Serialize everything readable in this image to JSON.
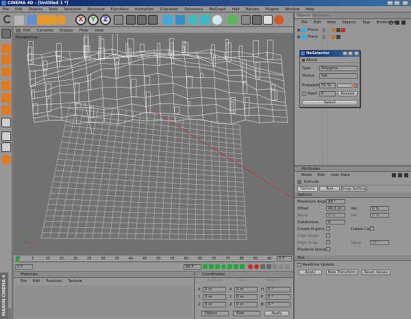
{
  "app": {
    "title": "CINEMA 4D - [Untitled 1 *]",
    "menu": [
      "File",
      "Edit",
      "Objects",
      "Tools",
      "Selection",
      "Structure",
      "Functions",
      "Animation",
      "Character",
      "Dynamics",
      "MoGraph",
      "Hair",
      "Render",
      "Plugins",
      "Window",
      "Help"
    ],
    "side_logo": "MAXON CINEMA 4D"
  },
  "toolbar": {
    "axis_x": "X",
    "axis_y": "Y",
    "axis_z": "Z",
    "icons": [
      "undo-icon",
      "redo-icon",
      "live-select-icon",
      "move-icon",
      "scale-icon",
      "rotate-icon",
      "x-axis-icon",
      "y-axis-icon",
      "z-axis-icon",
      "world-coordinates-icon",
      "render-view-icon",
      "render-picture-viewer-icon",
      "render-settings-icon",
      "cube-icon",
      "spline-pen-icon",
      "subdivision-icon",
      "array-icon",
      "flower-icon",
      "deformer-icon",
      "scene-icon",
      "camera-icon",
      "light-icon",
      "render-active-icon"
    ]
  },
  "viewport": {
    "menu": [
      "Edit",
      "Cameras",
      "Display",
      "Filter",
      "View"
    ],
    "label": "Perspective"
  },
  "object_manager": {
    "tabs": [
      "Objects",
      "Structure"
    ],
    "menu": [
      "File",
      "Edit",
      "View",
      "Objects",
      "Tags",
      "Bookmarks"
    ],
    "rows": [
      {
        "name": "Plane"
      },
      {
        "name": "Plane"
      }
    ]
  },
  "dialog": {
    "title": "NeSelector",
    "about_label": "About",
    "type_label": "Type",
    "type_value": "Polygons",
    "modus_label": "Modus",
    "modus_value": "Set",
    "probability_label": "Probability",
    "probability_value": "75 %",
    "probability_fraction": 0.75,
    "seed_label": "Seed",
    "seed_value": "0",
    "reseed_label": "Reseed",
    "select_label": "Select"
  },
  "attributes": {
    "title": "Attributes",
    "menu": [
      "Mode",
      "Edit",
      "User Data"
    ],
    "object_name": "Extrude",
    "tabs": [
      "Options",
      "Tool",
      "Snap Settings"
    ],
    "section_options": "Options",
    "max_angle_label": "Maximum Angle",
    "max_angle_value": "89 °",
    "offset_label": "Offset",
    "offset_value": "40.1 m",
    "var1_label": "Var.",
    "var1_value": "0 %",
    "bevel_label": "Bevel",
    "bevel_value": "0 m",
    "var2_label": "Var.",
    "var2_value": "0 %",
    "subdivision_label": "Subdivision",
    "subdivision_value": "0",
    "create_ngons_label": "Create N-gons",
    "create_caps_label": "Create Caps",
    "edge_angle_label": "Edge Angle",
    "edge_snap_label": "Edge Snap",
    "value_label": "Value",
    "value_value": "15 °",
    "preserve_groups_label": "Preserve Groups",
    "section_tool": "Tool",
    "realtime_label": "Realtime Update",
    "apply_label": "Apply",
    "new_transform_label": "New Transform",
    "reset_values_label": "Reset Values"
  },
  "timeline": {
    "ticks": [
      "0",
      "5",
      "10",
      "15",
      "20",
      "25",
      "30",
      "35",
      "40",
      "45",
      "50",
      "55",
      "60",
      "65",
      "70",
      "75",
      "80",
      "85",
      "90"
    ],
    "frame_end": "0 F",
    "field_start": "0 F",
    "field_end": "90 F",
    "field_cur": "90 F"
  },
  "materials": {
    "title": "Materials",
    "menu": [
      "File",
      "Edit",
      "Function",
      "Texture"
    ]
  },
  "coordinates": {
    "title": "Coordinates",
    "col_headers": [
      "Position",
      "Size",
      "Rotation"
    ],
    "rows": [
      {
        "axis": "X",
        "pos": "0 m",
        "size_label": "X",
        "size": "0 m",
        "rot_label": "H",
        "rot": "0 °"
      },
      {
        "axis": "Y",
        "pos": "0 m",
        "size_label": "Y",
        "size": "0 m",
        "rot_label": "P",
        "rot": "0 °"
      },
      {
        "axis": "Z",
        "pos": "0 m",
        "size_label": "Z",
        "size": "0 m",
        "rot_label": "B",
        "rot": "0 °"
      }
    ],
    "mode_value": "Object",
    "size_mode_value": "Size",
    "apply_label": "Apply"
  },
  "colors": {
    "title_bar": "#0a246a",
    "viewport_bg": "#727272",
    "panel_bg": "#979797",
    "accent_orange": "#e07a1f",
    "timeline_green": "#22a63c"
  }
}
